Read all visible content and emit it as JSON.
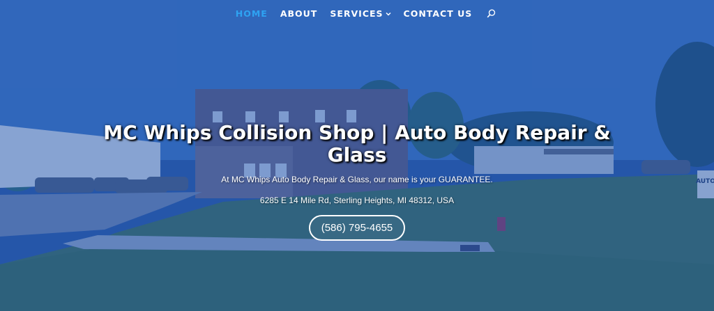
{
  "nav": {
    "items": [
      {
        "label": "HOME",
        "active": true
      },
      {
        "label": "ABOUT",
        "active": false
      },
      {
        "label": "SERVICES",
        "active": false
      },
      {
        "label": "CONTACT US",
        "active": false
      }
    ],
    "services_chevron": "⌄",
    "search_icon": "search-icon"
  },
  "hero": {
    "title": "MC Whips Collision Shop | Auto Body Repair & Glass",
    "tagline": "At MC Whips Auto Body Repair & Glass, our name is your GUARANTEE.",
    "address": "6285 E 14 Mile Rd, Sterling Heights, MI 48312, USA",
    "phone_button": "(586) 795-4655"
  },
  "scene_sign": "AUTO",
  "colors": {
    "active_nav": "#2ea3f2",
    "overlay": "#1e52aa",
    "text": "#ffffff"
  }
}
